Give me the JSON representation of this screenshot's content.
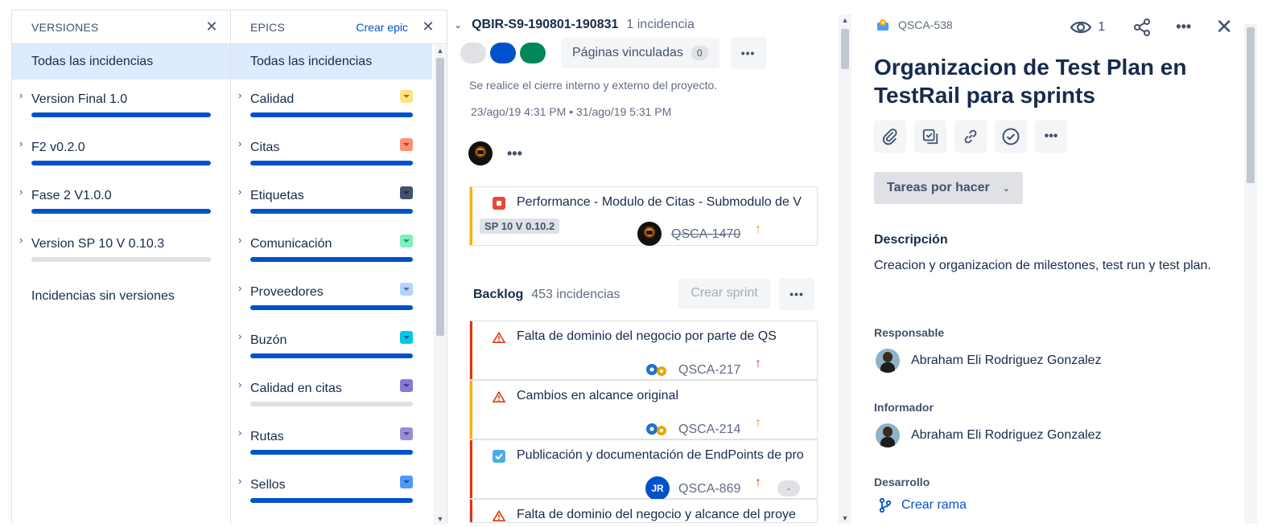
{
  "versions": {
    "title": "VERSIONES",
    "all": "Todas las incidencias",
    "items": [
      {
        "label": "Version Final 1.0",
        "progress": 1.0
      },
      {
        "label": "F2 v0.2.0",
        "progress": 1.0
      },
      {
        "label": "Fase 2 V1.0.0",
        "progress": 1.0
      },
      {
        "label": "Version SP 10 V 0.10.3",
        "progress": 0.0
      }
    ],
    "no_versions": "Incidencias sin versiones"
  },
  "epics": {
    "title": "EPICS",
    "create": "Crear epic",
    "all": "Todas las incidencias",
    "items": [
      {
        "label": "Calidad",
        "color": "#ffe380",
        "progress": 1.0
      },
      {
        "label": "Citas",
        "color": "#ff8f73",
        "progress": 1.0
      },
      {
        "label": "Etiquetas",
        "color": "#42526e",
        "progress": 1.0
      },
      {
        "label": "Comunicación",
        "color": "#79f2c0",
        "progress": 1.0
      },
      {
        "label": "Proveedores",
        "color": "#b3d4ff",
        "progress": 1.0
      },
      {
        "label": "Buzón",
        "color": "#00c7e6",
        "progress": 1.0
      },
      {
        "label": "Calidad en citas",
        "color": "#8777d9",
        "progress": 0.0
      },
      {
        "label": "Rutas",
        "color": "#998dd9",
        "progress": 1.0
      },
      {
        "label": "Sellos",
        "color": "#4c9aff",
        "progress": 1.0
      }
    ]
  },
  "sprint": {
    "name": "QBIR-S9-190801-190831",
    "count": "1 incidencia",
    "status_colors": [
      "#dfe1e6",
      "#0052cc",
      "#00875a"
    ],
    "linked_pages": "Páginas vinculadas",
    "linked_count": "0",
    "more": "•••",
    "goal": "Se realice el cierre interno y externo del proyecto.",
    "dates": "23/ago/19 4:31 PM  •  31/ago/19 5:31 PM",
    "issue": {
      "title": "Performance - Modulo de Citas - Submodulo de V",
      "tag": "SP 10 V 0.10.2",
      "key": "QSCA-1470",
      "priority_color": "#ff8b00",
      "stripe": "#ffab00"
    }
  },
  "backlog": {
    "title": "Backlog",
    "count": "453 incidencias",
    "create_sprint": "Crear sprint",
    "more": "•••",
    "issues": [
      {
        "title": "Falta de dominio del negocio por parte de QS",
        "key": "QSCA-217",
        "type": "risk",
        "priority_color": "#de350b",
        "stripe": "#de350b"
      },
      {
        "title": "Cambios en alcance original",
        "key": "QSCA-214",
        "type": "risk",
        "priority_color": "#ff8b00",
        "stripe": "#ffab00"
      },
      {
        "title": "Publicación y documentación de EndPoints de pro",
        "key": "QSCA-869",
        "type": "task",
        "priority_color": "#de350b",
        "stripe": "#de350b",
        "assignee": "JR",
        "estimate": "-"
      },
      {
        "title": "Falta de dominio del negocio y alcance del proye",
        "key": "",
        "type": "risk",
        "priority_color": "#de350b",
        "stripe": "#de350b"
      }
    ]
  },
  "detail": {
    "key": "QSCA-538",
    "watchers": "1",
    "title": "Organizacion de Test Plan en TestRail para sprints",
    "status": "Tareas por hacer",
    "description_label": "Descripción",
    "description": "Creacion y organizacion de milestones, test run y test plan.",
    "assignee_label": "Responsable",
    "assignee": "Abraham Eli Rodriguez Gonzalez",
    "reporter_label": "Informador",
    "reporter": "Abraham Eli Rodriguez Gonzalez",
    "development_label": "Desarrollo",
    "create_branch": "Crear rama"
  }
}
